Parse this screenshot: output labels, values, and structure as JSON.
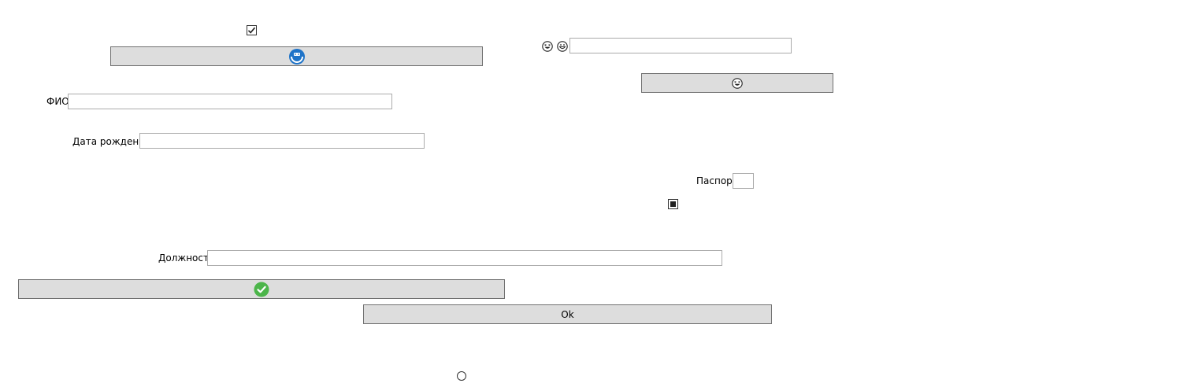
{
  "form": {
    "fio_label": "ФИО",
    "fio_value": "",
    "birth_label": "Дата рождения",
    "birth_value": "",
    "passport_label": "Паспорт",
    "passport_value": "",
    "position_label": "Должность",
    "position_value": "",
    "top_text_value": ""
  },
  "buttons": {
    "ok_label": "Ok"
  },
  "controls": {
    "top_checkbox_checked": true,
    "mid_checkbox_state": "indeterminate",
    "radio_selected": false
  },
  "icons": {
    "image_button_icon": "blue-badge-icon",
    "emoji_button_icon": "laughing-face-icon",
    "check_button_icon": "green-check-icon",
    "emoji_a": "laughing-face-icon",
    "emoji_b": "grinning-face-icon",
    "accent_blue": "#1e73c8",
    "accent_green": "#4cb54a"
  }
}
